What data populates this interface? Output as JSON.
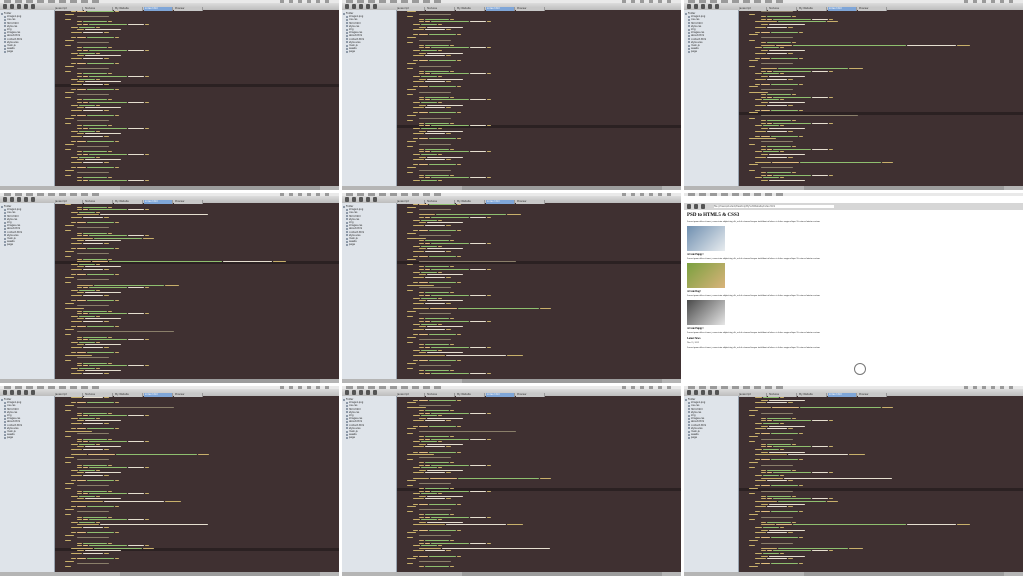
{
  "colors": {
    "editor_bg": "#3f3031",
    "tag": "#c8b06b",
    "attr": "#e0c080",
    "string": "#8fbf6f",
    "text": "#e6dfd0",
    "comment": "#8a7f6a",
    "highlight": "#2b2122",
    "sidebar_bg": "#dfe4ea",
    "tab_active": "#7fa6d8"
  },
  "editor_tabs": [
    "Javascript",
    "Textures",
    "My Website",
    "index.html",
    "Preview"
  ],
  "sidebar_items": [
    "Folder",
    "image1.png",
    "css.css",
    "html.html",
    "style.css",
    "img",
    "images.css",
    "about.html",
    "contact.html",
    "style.scss",
    "main.js",
    "assets",
    "page"
  ],
  "browser": {
    "url": "file:///Users/student/Desktop/My%20Website/index.html",
    "title": "PSD to HTML5 & CSS3",
    "paragraph": "Lorem ipsum dolor sit amet, consectetur adipisicing elit, sed do eiusmod tempor incididunt ut labore et dolore magna aliqua. Ut enim ad minim veniam.",
    "subheadings": [
      "A Cute Puppy!",
      "A Cute Dog!",
      "A Cute Puppy!"
    ],
    "latest_news": "Latest News",
    "date": "Nov 15, 2012"
  },
  "tiles": [
    {
      "type": "editor",
      "active_tab": 3,
      "variant": 0
    },
    {
      "type": "editor",
      "active_tab": 3,
      "variant": 1
    },
    {
      "type": "editor",
      "active_tab": 3,
      "variant": 2
    },
    {
      "type": "editor",
      "active_tab": 3,
      "variant": 3
    },
    {
      "type": "editor",
      "active_tab": 3,
      "variant": 3
    },
    {
      "type": "browser"
    },
    {
      "type": "editor",
      "active_tab": 3,
      "variant": 4
    },
    {
      "type": "editor",
      "active_tab": 3,
      "variant": 5
    },
    {
      "type": "editor",
      "active_tab": 3,
      "variant": 5
    }
  ]
}
